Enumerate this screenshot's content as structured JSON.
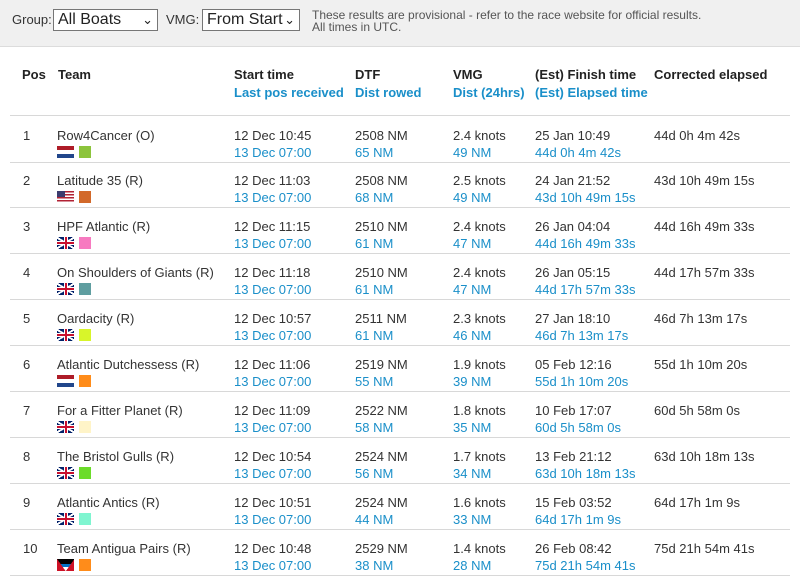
{
  "filters": {
    "group_label": "Group:",
    "group_value": "All Boats",
    "vmg_label": "VMG:",
    "vmg_value": "From Start",
    "notice_line1": "These results are provisional - refer to the race website for official results.",
    "notice_line2": "All times in UTC."
  },
  "columns": {
    "pos": "Pos",
    "team": "Team",
    "start": "Start time",
    "last_pos": "Last pos received",
    "dtf": "DTF",
    "dist_rowed": "Dist rowed",
    "vmg": "VMG",
    "dist24": "Dist (24hrs)",
    "est_finish": "(Est) Finish time",
    "est_elapsed": "(Est) Elapsed time",
    "corrected": "Corrected elapsed"
  },
  "rows": [
    {
      "pos": "1",
      "team": "Row4Cancer (O)",
      "flag": "nl-flag-icon",
      "swatch": "#8cc43c",
      "start": "12 Dec 10:45",
      "last_pos": "13 Dec 07:00",
      "dtf": "2508 NM",
      "rowed": "65 NM",
      "vmg": "2.4 knots",
      "dist24": "49 NM",
      "finish": "25 Jan 10:49",
      "elapsed": "44d 0h 4m 42s",
      "corrected": "44d 0h 4m 42s"
    },
    {
      "pos": "2",
      "team": "Latitude 35 (R)",
      "flag": "us-flag-icon",
      "swatch": "#d2692a",
      "start": "12 Dec 11:03",
      "last_pos": "13 Dec 07:00",
      "dtf": "2508 NM",
      "rowed": "68 NM",
      "vmg": "2.5 knots",
      "dist24": "49 NM",
      "finish": "24 Jan 21:52",
      "elapsed": "43d 10h 49m 15s",
      "corrected": "43d 10h 49m 15s"
    },
    {
      "pos": "3",
      "team": "HPF Atlantic (R)",
      "flag": "uk-flag-icon",
      "swatch": "#f77ac0",
      "start": "12 Dec 11:15",
      "last_pos": "13 Dec 07:00",
      "dtf": "2510 NM",
      "rowed": "61 NM",
      "vmg": "2.4 knots",
      "dist24": "47 NM",
      "finish": "26 Jan 04:04",
      "elapsed": "44d 16h 49m 33s",
      "corrected": "44d 16h 49m 33s"
    },
    {
      "pos": "4",
      "team": "On Shoulders of Giants (R)",
      "flag": "uk-flag-icon",
      "swatch": "#5f9ea0",
      "start": "12 Dec 11:18",
      "last_pos": "13 Dec 07:00",
      "dtf": "2510 NM",
      "rowed": "61 NM",
      "vmg": "2.4 knots",
      "dist24": "47 NM",
      "finish": "26 Jan 05:15",
      "elapsed": "44d 17h 57m 33s",
      "corrected": "44d 17h 57m 33s"
    },
    {
      "pos": "5",
      "team": "Oardacity (R)",
      "flag": "uk-flag-icon",
      "swatch": "#d8f52a",
      "start": "12 Dec 10:57",
      "last_pos": "13 Dec 07:00",
      "dtf": "2511 NM",
      "rowed": "61 NM",
      "vmg": "2.3 knots",
      "dist24": "46 NM",
      "finish": "27 Jan 18:10",
      "elapsed": "46d 7h 13m 17s",
      "corrected": "46d 7h 13m 17s"
    },
    {
      "pos": "6",
      "team": "Atlantic Dutchessess (R)",
      "flag": "nl-flag-icon",
      "swatch": "#ff8c1a",
      "start": "12 Dec 11:06",
      "last_pos": "13 Dec 07:00",
      "dtf": "2519 NM",
      "rowed": "55 NM",
      "vmg": "1.9 knots",
      "dist24": "39 NM",
      "finish": "05 Feb 12:16",
      "elapsed": "55d 1h 10m 20s",
      "corrected": "55d 1h 10m 20s"
    },
    {
      "pos": "7",
      "team": "For a Fitter Planet (R)",
      "flag": "uk-flag-icon",
      "swatch": "#fff4c8",
      "start": "12 Dec 11:09",
      "last_pos": "13 Dec 07:00",
      "dtf": "2522 NM",
      "rowed": "58 NM",
      "vmg": "1.8 knots",
      "dist24": "35 NM",
      "finish": "10 Feb 17:07",
      "elapsed": "60d 5h 58m 0s",
      "corrected": "60d 5h 58m 0s"
    },
    {
      "pos": "8",
      "team": "The Bristol Gulls (R)",
      "flag": "uk-flag-icon",
      "swatch": "#6cdc2a",
      "start": "12 Dec 10:54",
      "last_pos": "13 Dec 07:00",
      "dtf": "2524 NM",
      "rowed": "56 NM",
      "vmg": "1.7 knots",
      "dist24": "34 NM",
      "finish": "13 Feb 21:12",
      "elapsed": "63d 10h 18m 13s",
      "corrected": "63d 10h 18m 13s"
    },
    {
      "pos": "9",
      "team": "Atlantic Antics (R)",
      "flag": "uk-flag-icon",
      "swatch": "#7ff5d0",
      "start": "12 Dec 10:51",
      "last_pos": "13 Dec 07:00",
      "dtf": "2524 NM",
      "rowed": "44 NM",
      "vmg": "1.6 knots",
      "dist24": "33 NM",
      "finish": "15 Feb 03:52",
      "elapsed": "64d 17h 1m 9s",
      "corrected": "64d 17h 1m 9s"
    },
    {
      "pos": "10",
      "team": "Team Antigua Pairs (R)",
      "flag": "ag-flag-icon",
      "swatch": "#ff8c1a",
      "start": "12 Dec 10:48",
      "last_pos": "13 Dec 07:00",
      "dtf": "2529 NM",
      "rowed": "38 NM",
      "vmg": "1.4 knots",
      "dist24": "28 NM",
      "finish": "26 Feb 08:42",
      "elapsed": "75d 21h 54m 41s",
      "corrected": "75d 21h 54m 41s"
    }
  ]
}
